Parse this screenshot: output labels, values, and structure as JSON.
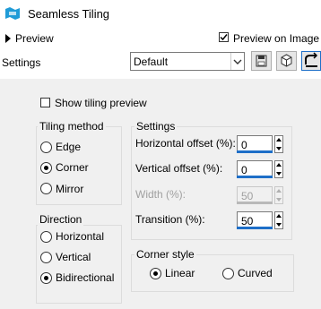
{
  "window": {
    "title": "Seamless Tiling",
    "icon": "seamless-tiling-app-icon"
  },
  "header": {
    "preview_label": "Preview",
    "preview_on_image_label": "Preview on Image",
    "preview_on_image_checked": true
  },
  "settings_bar": {
    "label": "Settings",
    "preset_value": "Default",
    "buttons": [
      "save-preset-icon",
      "randomize-icon",
      "reset-icon"
    ]
  },
  "show_tiling_preview": {
    "label": "Show tiling preview",
    "checked": false
  },
  "tiling_method": {
    "title": "Tiling method",
    "options": [
      "Edge",
      "Corner",
      "Mirror"
    ],
    "selected": "Corner"
  },
  "settings_group": {
    "title": "Settings",
    "horizontal_offset": {
      "label": "Horizontal offset (%):",
      "value": "0"
    },
    "vertical_offset": {
      "label": "Vertical offset (%):",
      "value": "0"
    },
    "width": {
      "label": "Width (%):",
      "value": "50",
      "disabled": true
    },
    "transition": {
      "label": "Transition (%):",
      "value": "50"
    }
  },
  "direction": {
    "title": "Direction",
    "options": [
      "Horizontal",
      "Vertical",
      "Bidirectional"
    ],
    "selected": "Bidirectional"
  },
  "corner_style": {
    "title": "Corner style",
    "options": [
      "Linear",
      "Curved"
    ],
    "selected": "Linear"
  },
  "colors": {
    "accent": "#1e6fc8",
    "panel": "#f0f0f0"
  }
}
